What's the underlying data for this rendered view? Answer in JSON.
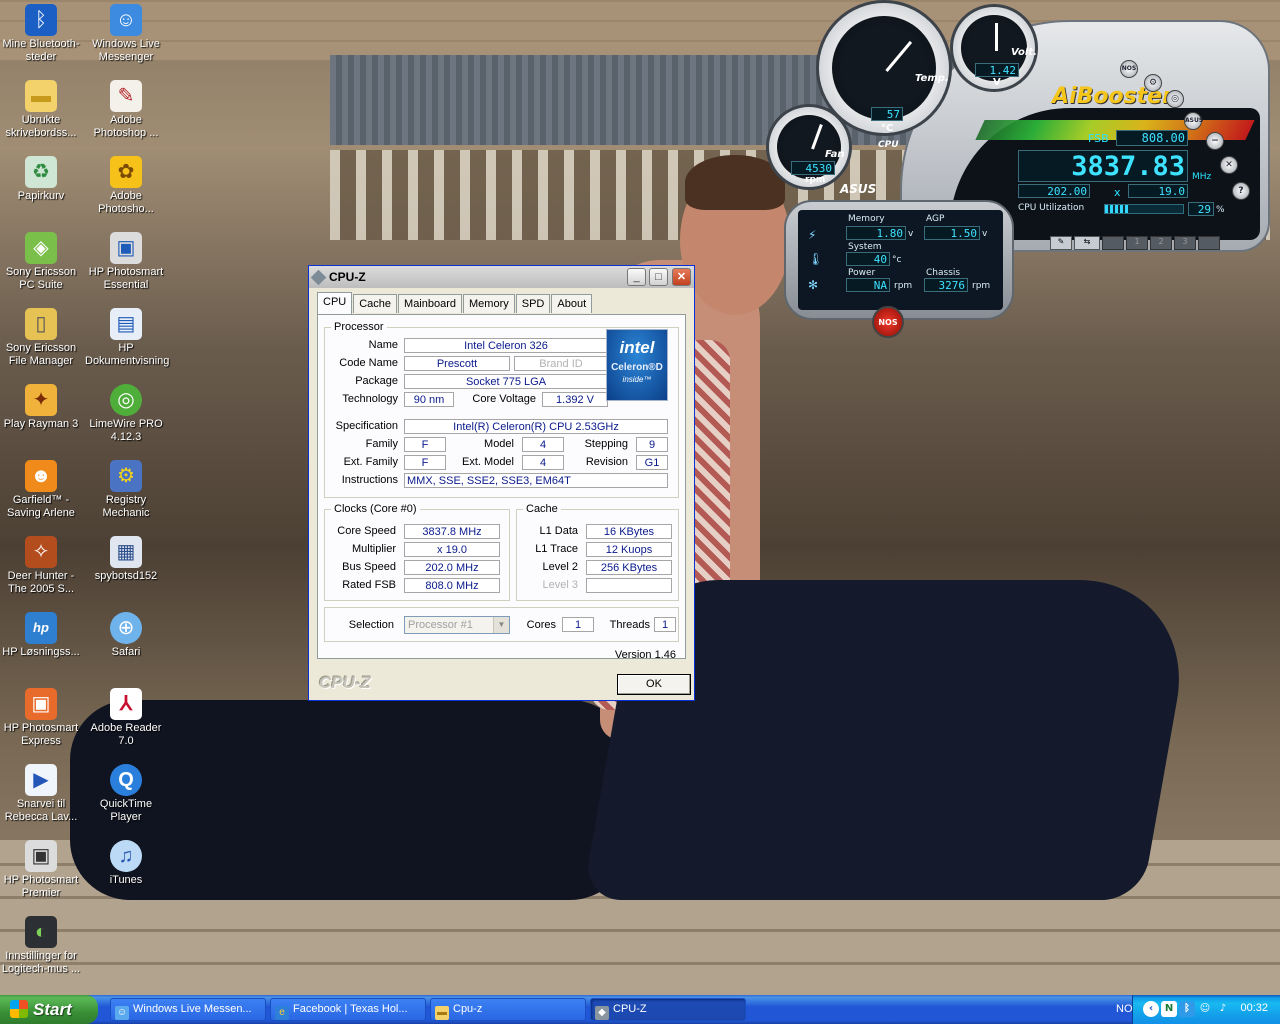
{
  "desktop": {
    "icons": [
      {
        "label": "Mine Bluetooth-steder",
        "icon": "bluetooth-icon",
        "glyph": "ᛒ"
      },
      {
        "label": "Windows Live Messenger",
        "icon": "messenger-icon",
        "glyph": "☺"
      },
      {
        "label": "Ubrukte skrivebordss...",
        "icon": "folder-icon",
        "glyph": "▬"
      },
      {
        "label": "Adobe Photoshop ...",
        "icon": "photoshop-icon",
        "glyph": "✎"
      },
      {
        "label": "Papirkurv",
        "icon": "recycle-bin-icon",
        "glyph": "♻"
      },
      {
        "label": "Adobe Photosho...",
        "icon": "photoshop-album-icon",
        "glyph": "✿"
      },
      {
        "label": "Sony Ericsson PC Suite",
        "icon": "pc-suite-icon",
        "glyph": "◈"
      },
      {
        "label": "HP Photosmart Essential",
        "icon": "hp-photosmart-icon",
        "glyph": "▣"
      },
      {
        "label": "Sony Ericsson File Manager",
        "icon": "file-manager-icon",
        "glyph": "▯"
      },
      {
        "label": "HP Dokumentvisning",
        "icon": "hp-document-icon",
        "glyph": "▤"
      },
      {
        "label": "Play Rayman 3",
        "icon": "rayman-icon",
        "glyph": "✦"
      },
      {
        "label": "LimeWire PRO 4.12.3",
        "icon": "limewire-icon",
        "glyph": "◎"
      },
      {
        "label": "Garfield™ - Saving Arlene",
        "icon": "garfield-icon",
        "glyph": "☻"
      },
      {
        "label": "Registry Mechanic",
        "icon": "registry-mechanic-icon",
        "glyph": "⚙"
      },
      {
        "label": "Deer Hunter - The 2005 S...",
        "icon": "deer-hunter-icon",
        "glyph": "✧"
      },
      {
        "label": "spybotsd152",
        "icon": "spybot-icon",
        "glyph": "▦"
      },
      {
        "label": "HP Løsningss...",
        "icon": "hp-solution-icon",
        "glyph": "hp"
      },
      {
        "label": "Safari",
        "icon": "safari-icon",
        "glyph": "⊕"
      },
      {
        "label": "HP Photosmart Express",
        "icon": "hp-express-icon",
        "glyph": "▣"
      },
      {
        "label": "Adobe Reader 7.0",
        "icon": "adobe-reader-icon",
        "glyph": "⅄"
      },
      {
        "label": "Snarvei til Rebecca Lav...",
        "icon": "shortcut-icon",
        "glyph": "▶"
      },
      {
        "label": "QuickTime Player",
        "icon": "quicktime-icon",
        "glyph": "Q"
      },
      {
        "label": "HP Photosmart Premier",
        "icon": "hp-premier-icon",
        "glyph": "▣"
      },
      {
        "label": "iTunes",
        "icon": "itunes-icon",
        "glyph": "♫"
      },
      {
        "label": "Innstillinger for Logitech-mus ...",
        "icon": "logitech-mouse-icon",
        "glyph": "◐"
      }
    ]
  },
  "cpuz": {
    "title": "CPU-Z",
    "tabs": [
      "CPU",
      "Cache",
      "Mainboard",
      "Memory",
      "SPD",
      "About"
    ],
    "processor": {
      "legend": "Processor",
      "name_label": "Name",
      "name": "Intel Celeron 326",
      "codename_label": "Code Name",
      "codename": "Prescott",
      "brandid_label": "Brand ID",
      "brandid": "",
      "package_label": "Package",
      "package": "Socket 775 LGA",
      "technology_label": "Technology",
      "technology": "90 nm",
      "corevoltage_label": "Core Voltage",
      "corevoltage": "1.392 V",
      "specification_label": "Specification",
      "specification": "Intel(R) Celeron(R) CPU 2.53GHz",
      "family_label": "Family",
      "family": "F",
      "model_label": "Model",
      "model": "4",
      "stepping_label": "Stepping",
      "stepping": "9",
      "extfamily_label": "Ext. Family",
      "extfamily": "F",
      "extmodel_label": "Ext. Model",
      "extmodel": "4",
      "revision_label": "Revision",
      "revision": "G1",
      "instructions_label": "Instructions",
      "instructions": "MMX, SSE, SSE2, SSE3, EM64T",
      "logo_brand": "intel",
      "logo_product": "Celeron®D",
      "logo_inside": "inside™"
    },
    "clocks": {
      "legend": "Clocks (Core #0)",
      "corespeed_label": "Core Speed",
      "corespeed": "3837.8 MHz",
      "multiplier_label": "Multiplier",
      "multiplier": "x 19.0",
      "busspeed_label": "Bus Speed",
      "busspeed": "202.0 MHz",
      "ratedfsb_label": "Rated FSB",
      "ratedfsb": "808.0 MHz"
    },
    "cache": {
      "legend": "Cache",
      "l1data_label": "L1 Data",
      "l1data": "16 KBytes",
      "l1trace_label": "L1 Trace",
      "l1trace": "12 Kuops",
      "level2_label": "Level 2",
      "level2": "256 KBytes",
      "level3_label": "Level 3",
      "level3": ""
    },
    "selection": {
      "label": "Selection",
      "value": "Processor #1",
      "cores_label": "Cores",
      "cores": "1",
      "threads_label": "Threads",
      "threads": "1"
    },
    "version": "Version 1.46",
    "brand_watermark": "CPU-Z",
    "ok_label": "OK"
  },
  "aibooster": {
    "logo": "AiBooster",
    "brand": "ASUS",
    "cpu_label": "CPU",
    "temp_label": "Temp.",
    "temp_value": "57",
    "temp_unit": "°C",
    "volt_label": "Volt.",
    "volt_value": "1.42",
    "volt_unit": "V",
    "fan_label": "Fan",
    "fan_value": "4530",
    "fan_unit": "rpm",
    "fsb_label": "FSB",
    "fsb_value": "808.00",
    "mhz_value": "3837.83",
    "mhz_unit": "MHz",
    "bus_value": "202.00",
    "multiply_sign": "x",
    "multi_value": "19.0",
    "cpu_util_label": "CPU Utilization",
    "cpu_util_value": "29",
    "cpu_util_unit": "%",
    "cpu_util_fraction": 0.29,
    "memory_label": "Memory",
    "memory_value": "1.80",
    "memory_unit": "v",
    "agp_label": "AGP",
    "agp_value": "1.50",
    "agp_unit": "v",
    "system_label": "System",
    "system_value": "40",
    "system_unit": "°c",
    "power_label": "Power",
    "power_value": "NA",
    "power_unit": "rpm",
    "chassis_label": "Chassis",
    "chassis_value": "3276",
    "chassis_unit": "rpm",
    "nos_label": "NOS",
    "nos_top_label": "NOS",
    "asus_btn_label": "ASUS",
    "help_label": "?",
    "tab_numbers": [
      "1",
      "2",
      "3"
    ]
  },
  "taskbar": {
    "start_label": "Start",
    "tasks": [
      {
        "label": "Windows Live Messen...",
        "icon": "messenger-icon"
      },
      {
        "label": "Facebook | Texas Hol...",
        "icon": "browser-icon"
      },
      {
        "label": "Cpu-z",
        "icon": "folder-icon"
      },
      {
        "label": "CPU-Z",
        "icon": "cpuz-icon"
      }
    ],
    "language": "NO",
    "clock": "00:32"
  }
}
